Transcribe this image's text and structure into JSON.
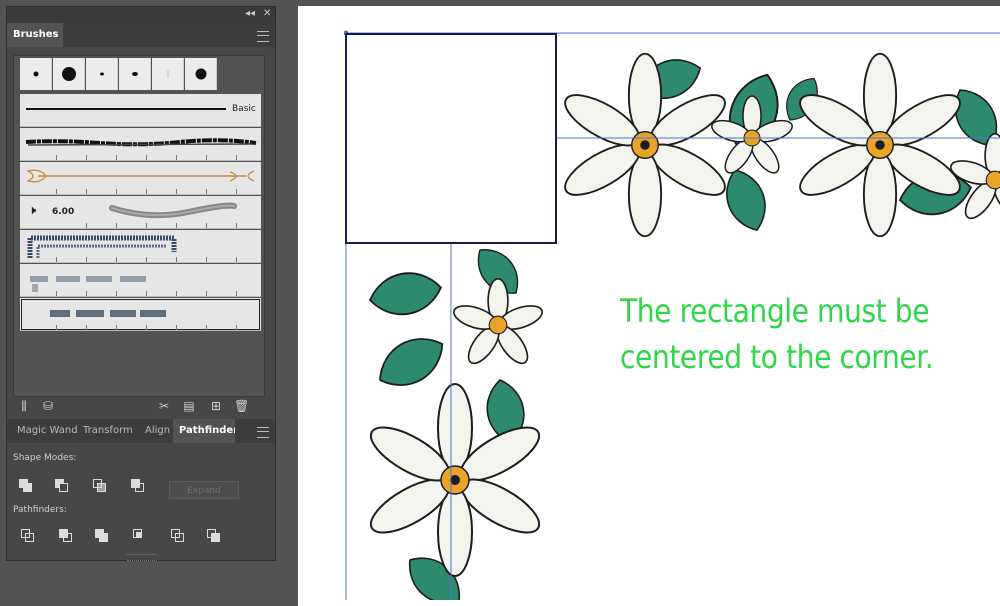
{
  "brushes_panel": {
    "tab_label": "Brushes",
    "basic_label": "Basic",
    "brush_size_label": "6.00"
  },
  "bottom_panel": {
    "tabs": [
      "Magic Wand",
      "Transform",
      "Align",
      "Pathfinder"
    ],
    "active_tab": "Pathfinder",
    "shape_modes_label": "Shape Modes:",
    "pathfinders_label": "Pathfinders:",
    "expand_label": "Expand"
  },
  "canvas": {
    "annotation_line1": "The rectangle must be",
    "annotation_line2": "centered to the corner."
  },
  "colors": {
    "annotation": "#2fd64a",
    "leaf": "#2e8a6e",
    "petal": "#f3f4ee",
    "stamen": "#e9a32b",
    "selection": "#4a74d4",
    "rectangle_stroke": "#1a1d4a"
  }
}
